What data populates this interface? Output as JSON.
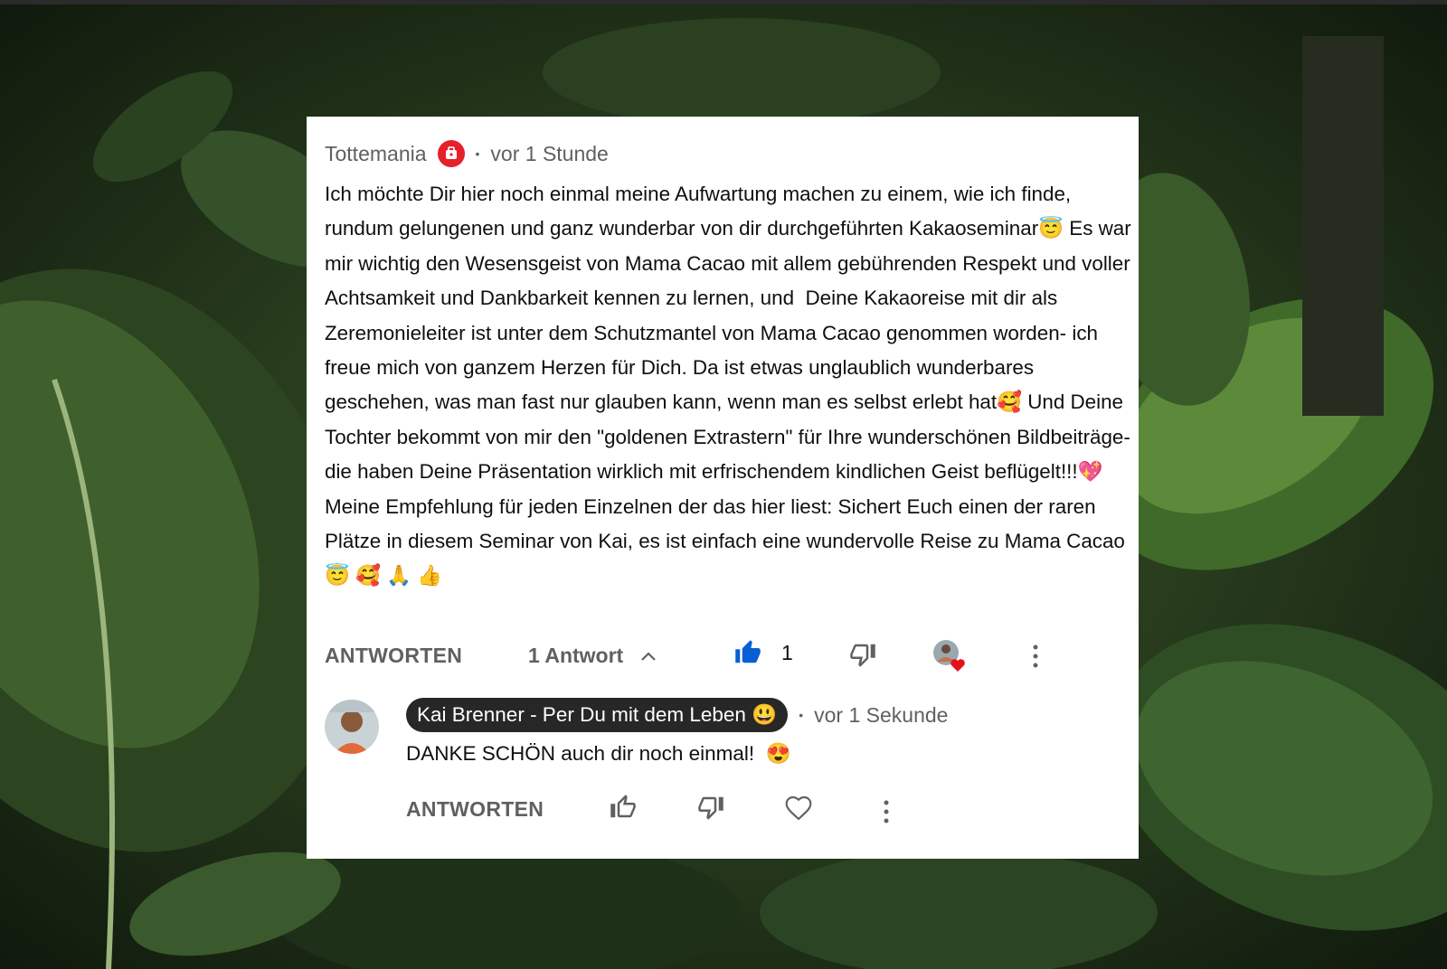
{
  "comment": {
    "author": "Tottemania",
    "badge_icon": "membership-badge-icon",
    "time": "vor 1 Stunde",
    "text_parts": [
      "Ich möchte Dir hier noch einmal meine Aufwartung machen zu einem, wie ich finde, rundum gelungenen und ganz wunderbar von dir durchgeführten Kakaoseminar",
      " Es war mir wichtig den Wesensgeist von Mama Cacao mit allem gebührenden Respekt und voller Achtsamkeit und Dankbarkeit kennen zu lernen, und  Deine Kakaoreise mit dir als Zeremonieleiter ist unter dem Schutzmantel von Mama Cacao genommen worden- ich freue mich von ganzem Herzen für Dich. Da ist etwas unglaublich wunderbares geschehen, was man fast nur glauben kann, wenn man es selbst erlebt hat",
      " Und Deine Tochter bekommt von mir den \"goldenen Extrastern\" für Ihre wunderschönen Bildbeiträge- die haben Deine Präsentation wirklich mit erfrischendem kindlichen Geist beflügelt!!!",
      "\nMeine Empfehlung für jeden Einzelnen der das hier liest: Sichert Euch einen der raren Plätze in diesem Seminar von Kai, es ist einfach eine wundervolle Reise zu Mama Cacao"
    ],
    "emojis": [
      "😇",
      "🥰",
      "💖",
      "😇",
      "🥰",
      "🙏",
      "👍"
    ],
    "reply_label": "ANTWORTEN",
    "replies_label": "1 Antwort",
    "like_count": "1",
    "colors": {
      "like_active": "#065fd4",
      "badge": "#e5202b",
      "heart": "#e3121e"
    }
  },
  "reply": {
    "author": "Kai Brenner - Per Du mit dem Leben",
    "author_emoji": "😃",
    "time": "vor 1 Sekunde",
    "text": "DANKE SCHÖN auch dir noch einmal!",
    "text_emoji": "😍",
    "reply_label": "ANTWORTEN"
  }
}
